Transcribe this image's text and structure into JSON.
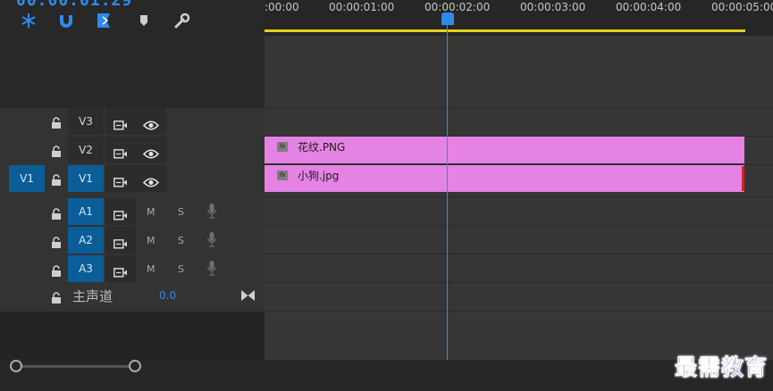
{
  "header": {
    "timecode": "00:00:01:29",
    "tools": [
      "snap-icon",
      "linked-selection-icon",
      "add-marker-icon",
      "marker-icon",
      "wrench-icon"
    ]
  },
  "ruler": {
    "labels": [
      ":00:00",
      "00:00:01:00",
      "00:00:02:00",
      "00:00:03:00",
      "00:00:04:00",
      "00:00:05:00"
    ]
  },
  "video_tracks": [
    {
      "name": "V3",
      "source_patch": ""
    },
    {
      "name": "V2",
      "source_patch": ""
    },
    {
      "name": "V1",
      "source_patch": "V1"
    }
  ],
  "audio_tracks": [
    {
      "name": "A1",
      "mute": "M",
      "solo": "S"
    },
    {
      "name": "A2",
      "mute": "M",
      "solo": "S"
    },
    {
      "name": "A3",
      "mute": "M",
      "solo": "S"
    }
  ],
  "master": {
    "label": "主声道",
    "value": "0.0"
  },
  "clips": [
    {
      "track": "V2",
      "name": "花纹.PNG",
      "fx": "fx"
    },
    {
      "track": "V1",
      "name": "小狗.jpg",
      "fx": "fx"
    }
  ],
  "watermark": "最需教育",
  "colors": {
    "accent": "#2d8ceb",
    "clip": "#e483e3",
    "workarea": "#e3d21f",
    "patch": "#0a5d96"
  }
}
